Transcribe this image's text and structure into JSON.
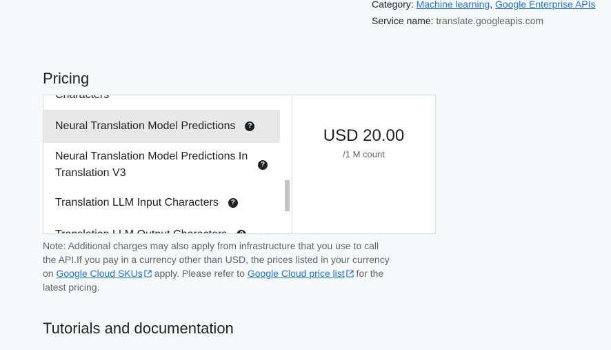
{
  "meta": {
    "category_label": "Category:",
    "category_links": [
      "Machine learning",
      "Google Enterprise APIs"
    ],
    "separator": ",",
    "service_label": "Service name:",
    "service_value": "translate.googleapis.com"
  },
  "pricing": {
    "title": "Pricing",
    "skus": [
      {
        "label": "Characters"
      },
      {
        "label": "Neural Translation Model Predictions",
        "selected": true
      },
      {
        "label": "Neural Translation Model Predictions In Translation V3"
      },
      {
        "label": "Translation LLM Input Characters"
      },
      {
        "label": "Translation LLM Output Characters"
      }
    ],
    "help_glyph": "?",
    "price": "USD 20.00",
    "unit": "/1 M count"
  },
  "note": {
    "part1": "Note: Additional charges may also apply from infrastructure that you use to call the API.If you pay in a currency other than USD, the prices listed in your currency on ",
    "link1": "Google Cloud SKUs",
    "part2": " apply. Please refer to ",
    "link2": "Google Cloud price list",
    "part3": " for the latest pricing."
  },
  "tutorials": {
    "title": "Tutorials and documentation"
  },
  "colors": {
    "link": "#1a73e8",
    "selected_bg": "#e8e8e8",
    "border": "#dadce0"
  },
  "icons": [
    "help-icon",
    "external-link-icon"
  ]
}
